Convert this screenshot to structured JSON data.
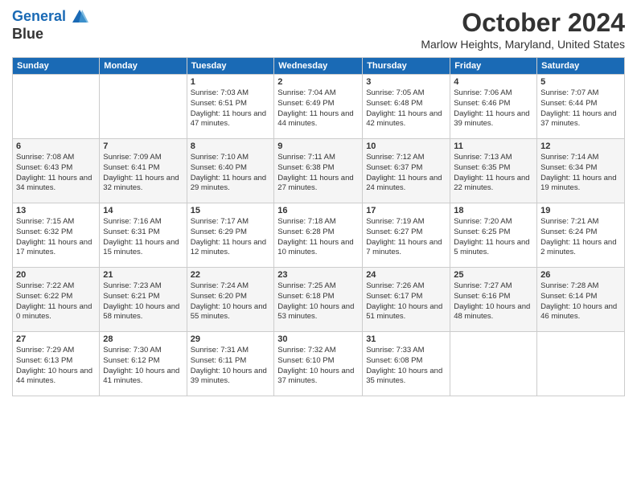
{
  "header": {
    "logo_line1": "General",
    "logo_line2": "Blue",
    "month_year": "October 2024",
    "location": "Marlow Heights, Maryland, United States"
  },
  "days_of_week": [
    "Sunday",
    "Monday",
    "Tuesday",
    "Wednesday",
    "Thursday",
    "Friday",
    "Saturday"
  ],
  "weeks": [
    [
      {
        "day": "",
        "sunrise": "",
        "sunset": "",
        "daylight": ""
      },
      {
        "day": "",
        "sunrise": "",
        "sunset": "",
        "daylight": ""
      },
      {
        "day": "1",
        "sunrise": "Sunrise: 7:03 AM",
        "sunset": "Sunset: 6:51 PM",
        "daylight": "Daylight: 11 hours and 47 minutes."
      },
      {
        "day": "2",
        "sunrise": "Sunrise: 7:04 AM",
        "sunset": "Sunset: 6:49 PM",
        "daylight": "Daylight: 11 hours and 44 minutes."
      },
      {
        "day": "3",
        "sunrise": "Sunrise: 7:05 AM",
        "sunset": "Sunset: 6:48 PM",
        "daylight": "Daylight: 11 hours and 42 minutes."
      },
      {
        "day": "4",
        "sunrise": "Sunrise: 7:06 AM",
        "sunset": "Sunset: 6:46 PM",
        "daylight": "Daylight: 11 hours and 39 minutes."
      },
      {
        "day": "5",
        "sunrise": "Sunrise: 7:07 AM",
        "sunset": "Sunset: 6:44 PM",
        "daylight": "Daylight: 11 hours and 37 minutes."
      }
    ],
    [
      {
        "day": "6",
        "sunrise": "Sunrise: 7:08 AM",
        "sunset": "Sunset: 6:43 PM",
        "daylight": "Daylight: 11 hours and 34 minutes."
      },
      {
        "day": "7",
        "sunrise": "Sunrise: 7:09 AM",
        "sunset": "Sunset: 6:41 PM",
        "daylight": "Daylight: 11 hours and 32 minutes."
      },
      {
        "day": "8",
        "sunrise": "Sunrise: 7:10 AM",
        "sunset": "Sunset: 6:40 PM",
        "daylight": "Daylight: 11 hours and 29 minutes."
      },
      {
        "day": "9",
        "sunrise": "Sunrise: 7:11 AM",
        "sunset": "Sunset: 6:38 PM",
        "daylight": "Daylight: 11 hours and 27 minutes."
      },
      {
        "day": "10",
        "sunrise": "Sunrise: 7:12 AM",
        "sunset": "Sunset: 6:37 PM",
        "daylight": "Daylight: 11 hours and 24 minutes."
      },
      {
        "day": "11",
        "sunrise": "Sunrise: 7:13 AM",
        "sunset": "Sunset: 6:35 PM",
        "daylight": "Daylight: 11 hours and 22 minutes."
      },
      {
        "day": "12",
        "sunrise": "Sunrise: 7:14 AM",
        "sunset": "Sunset: 6:34 PM",
        "daylight": "Daylight: 11 hours and 19 minutes."
      }
    ],
    [
      {
        "day": "13",
        "sunrise": "Sunrise: 7:15 AM",
        "sunset": "Sunset: 6:32 PM",
        "daylight": "Daylight: 11 hours and 17 minutes."
      },
      {
        "day": "14",
        "sunrise": "Sunrise: 7:16 AM",
        "sunset": "Sunset: 6:31 PM",
        "daylight": "Daylight: 11 hours and 15 minutes."
      },
      {
        "day": "15",
        "sunrise": "Sunrise: 7:17 AM",
        "sunset": "Sunset: 6:29 PM",
        "daylight": "Daylight: 11 hours and 12 minutes."
      },
      {
        "day": "16",
        "sunrise": "Sunrise: 7:18 AM",
        "sunset": "Sunset: 6:28 PM",
        "daylight": "Daylight: 11 hours and 10 minutes."
      },
      {
        "day": "17",
        "sunrise": "Sunrise: 7:19 AM",
        "sunset": "Sunset: 6:27 PM",
        "daylight": "Daylight: 11 hours and 7 minutes."
      },
      {
        "day": "18",
        "sunrise": "Sunrise: 7:20 AM",
        "sunset": "Sunset: 6:25 PM",
        "daylight": "Daylight: 11 hours and 5 minutes."
      },
      {
        "day": "19",
        "sunrise": "Sunrise: 7:21 AM",
        "sunset": "Sunset: 6:24 PM",
        "daylight": "Daylight: 11 hours and 2 minutes."
      }
    ],
    [
      {
        "day": "20",
        "sunrise": "Sunrise: 7:22 AM",
        "sunset": "Sunset: 6:22 PM",
        "daylight": "Daylight: 11 hours and 0 minutes."
      },
      {
        "day": "21",
        "sunrise": "Sunrise: 7:23 AM",
        "sunset": "Sunset: 6:21 PM",
        "daylight": "Daylight: 10 hours and 58 minutes."
      },
      {
        "day": "22",
        "sunrise": "Sunrise: 7:24 AM",
        "sunset": "Sunset: 6:20 PM",
        "daylight": "Daylight: 10 hours and 55 minutes."
      },
      {
        "day": "23",
        "sunrise": "Sunrise: 7:25 AM",
        "sunset": "Sunset: 6:18 PM",
        "daylight": "Daylight: 10 hours and 53 minutes."
      },
      {
        "day": "24",
        "sunrise": "Sunrise: 7:26 AM",
        "sunset": "Sunset: 6:17 PM",
        "daylight": "Daylight: 10 hours and 51 minutes."
      },
      {
        "day": "25",
        "sunrise": "Sunrise: 7:27 AM",
        "sunset": "Sunset: 6:16 PM",
        "daylight": "Daylight: 10 hours and 48 minutes."
      },
      {
        "day": "26",
        "sunrise": "Sunrise: 7:28 AM",
        "sunset": "Sunset: 6:14 PM",
        "daylight": "Daylight: 10 hours and 46 minutes."
      }
    ],
    [
      {
        "day": "27",
        "sunrise": "Sunrise: 7:29 AM",
        "sunset": "Sunset: 6:13 PM",
        "daylight": "Daylight: 10 hours and 44 minutes."
      },
      {
        "day": "28",
        "sunrise": "Sunrise: 7:30 AM",
        "sunset": "Sunset: 6:12 PM",
        "daylight": "Daylight: 10 hours and 41 minutes."
      },
      {
        "day": "29",
        "sunrise": "Sunrise: 7:31 AM",
        "sunset": "Sunset: 6:11 PM",
        "daylight": "Daylight: 10 hours and 39 minutes."
      },
      {
        "day": "30",
        "sunrise": "Sunrise: 7:32 AM",
        "sunset": "Sunset: 6:10 PM",
        "daylight": "Daylight: 10 hours and 37 minutes."
      },
      {
        "day": "31",
        "sunrise": "Sunrise: 7:33 AM",
        "sunset": "Sunset: 6:08 PM",
        "daylight": "Daylight: 10 hours and 35 minutes."
      },
      {
        "day": "",
        "sunrise": "",
        "sunset": "",
        "daylight": ""
      },
      {
        "day": "",
        "sunrise": "",
        "sunset": "",
        "daylight": ""
      }
    ]
  ]
}
